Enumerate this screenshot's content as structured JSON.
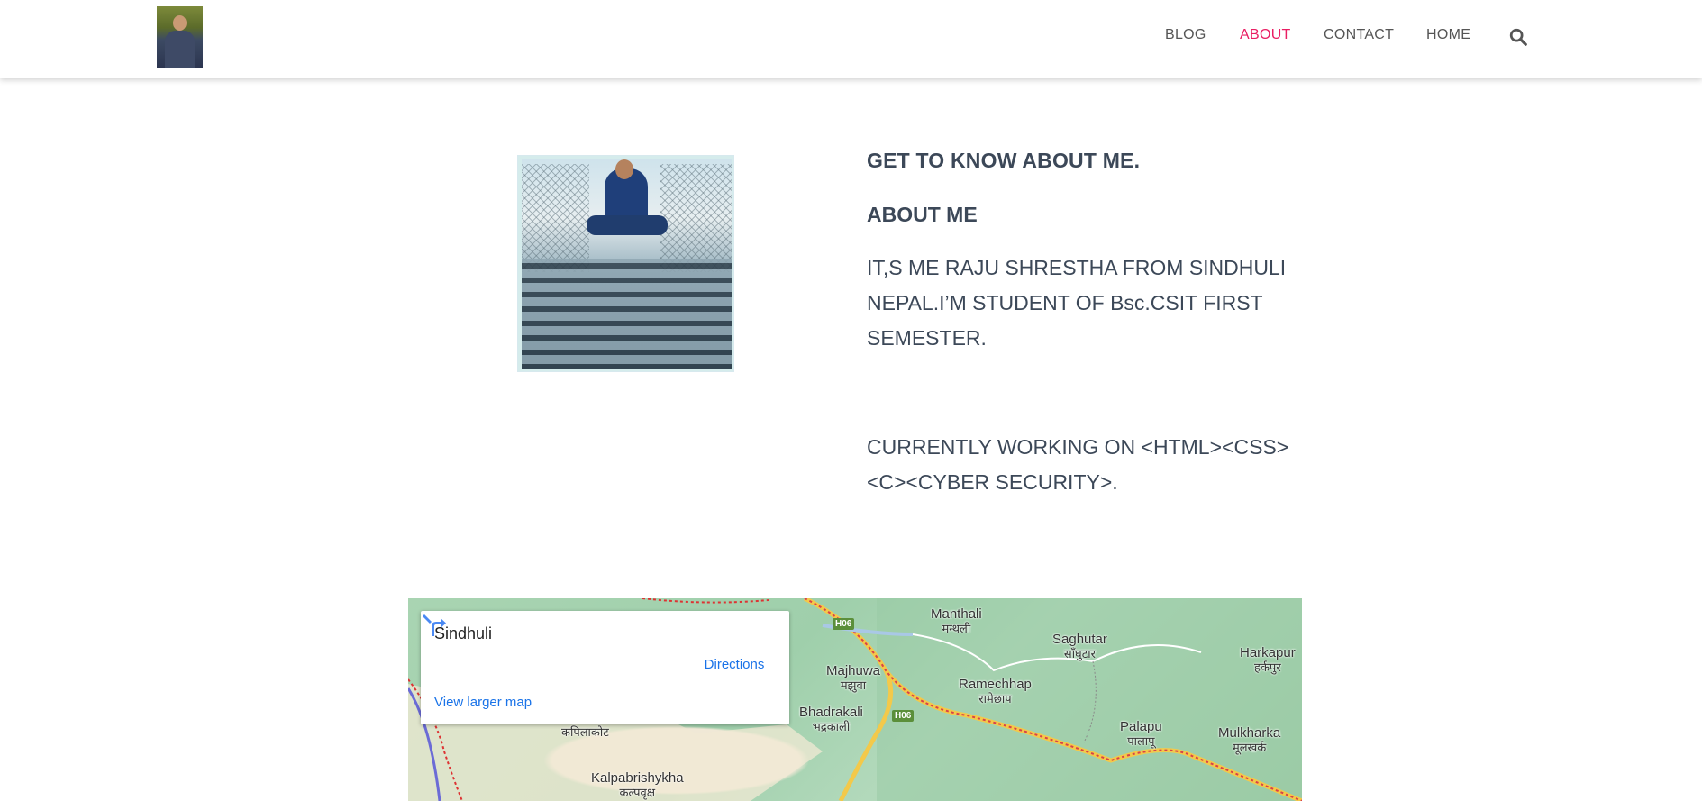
{
  "header": {
    "nav": [
      {
        "label": "BLOG",
        "active": false
      },
      {
        "label": "ABOUT",
        "active": true
      },
      {
        "label": "CONTACT",
        "active": false
      },
      {
        "label": "HOME",
        "active": false
      }
    ],
    "search_icon": "search-icon",
    "active_color": "#e91e63"
  },
  "about": {
    "heading": "GET TO KNOW ABOUT ME.",
    "subheading": "ABOUT ME",
    "paragraph1": "IT,S ME RAJU SHRESTHA FROM SINDHULI NEPAL.I’M STUDENT OF Bsc.CSIT FIRST SEMESTER.",
    "paragraph2": "CURRENTLY WORKING ON <HTML><CSS><C><CYBER SECURITY>."
  },
  "map": {
    "place_name": "Sindhuli",
    "directions_label": "Directions",
    "larger_map_label": "View larger map",
    "labels": [
      {
        "name": "Manthali",
        "dev": "मन्थली"
      },
      {
        "name": "Saghutar",
        "dev": "साँघुटार"
      },
      {
        "name": "Harkapur",
        "dev": "हर्कपुर"
      },
      {
        "name": "Majhuwa",
        "dev": "मझुवा"
      },
      {
        "name": "Ramechhap",
        "dev": "रामेछाप"
      },
      {
        "name": "Bhadrakali",
        "dev": "भद्रकाली"
      },
      {
        "name": "Palapu",
        "dev": "पालापू"
      },
      {
        "name": "Mulkharka",
        "dev": "मूलखर्क"
      },
      {
        "name": "",
        "dev": "कपिलाकोट"
      },
      {
        "name": "Kalpabrishykha",
        "dev": "कल्पवृक्ष"
      }
    ],
    "route_badges": [
      "H06",
      "H06"
    ]
  }
}
